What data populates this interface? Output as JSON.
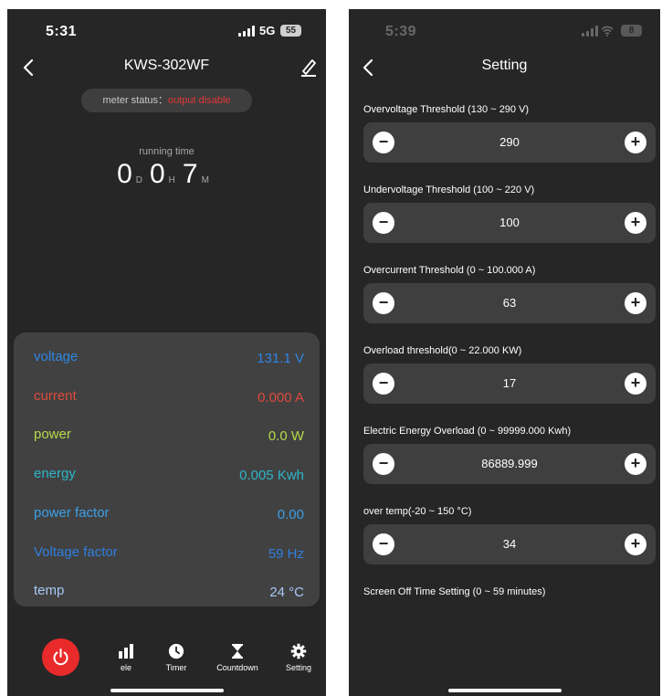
{
  "left": {
    "status_bar": {
      "time": "5:31",
      "network": "5G",
      "battery": "55"
    },
    "title": "KWS-302WF",
    "meter_status": {
      "label": "meter status：",
      "value": "output disable"
    },
    "running_time": {
      "label": "running time",
      "days": "0",
      "days_unit": "D",
      "hours": "0",
      "hours_unit": "H",
      "minutes": "7",
      "minutes_unit": "M"
    },
    "readings": [
      {
        "label": "voltage",
        "value": "131.1 V",
        "color": "#2f86e0"
      },
      {
        "label": "current",
        "value": "0.000 A",
        "color": "#e04a3c"
      },
      {
        "label": "power",
        "value": "0.0 W",
        "color": "#b8d94a"
      },
      {
        "label": "energy",
        "value": "0.005 Kwh",
        "color": "#2db6c8"
      },
      {
        "label": "power factor",
        "value": "0.00",
        "color": "#3aa0e8"
      },
      {
        "label": "Voltage factor",
        "value": "59 Hz",
        "color": "#2f7fe0"
      },
      {
        "label": "temp",
        "value": "24  °C",
        "color": "#a9c8f5"
      }
    ],
    "tabs": [
      {
        "label": "ele",
        "icon": "bar-chart-icon"
      },
      {
        "label": "Timer",
        "icon": "clock-icon"
      },
      {
        "label": "Countdown",
        "icon": "hourglass-icon"
      },
      {
        "label": "Setting",
        "icon": "gear-icon"
      }
    ]
  },
  "right": {
    "status_bar": {
      "time": "5:39",
      "battery": "8"
    },
    "title": "Setting",
    "settings": [
      {
        "label": "Overvoltage Threshold (130 ~ 290 V)",
        "value": "290"
      },
      {
        "label": "Undervoltage Threshold (100 ~ 220 V)",
        "value": "100"
      },
      {
        "label": "Overcurrent Threshold (0 ~ 100.000 A)",
        "value": "63"
      },
      {
        "label": "Overload threshold(0 ~ 22.000 KW)",
        "value": "17"
      },
      {
        "label": "Electric Energy Overload (0 ~ 99999.000 Kwh)",
        "value": "86889.999"
      },
      {
        "label": "over temp(-20 ~ 150 °C)",
        "value": "34"
      }
    ],
    "screen_off_label": "Screen Off Time Setting (0 ~ 59 minutes)",
    "minus_symbol": "−",
    "plus_symbol": "+"
  }
}
